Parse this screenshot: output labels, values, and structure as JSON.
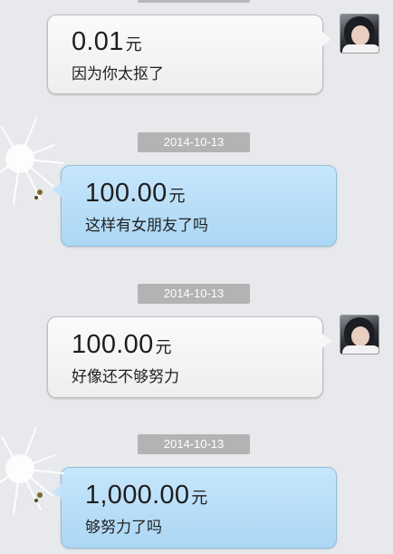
{
  "colors": {
    "background": "#e7e9ec",
    "timestamp_bg": "#b3b3b3",
    "outgoing_bubble": "#f4f4f4",
    "incoming_bubble": "#b8ddf7"
  },
  "messages": [
    {
      "direction": "outgoing",
      "amount": "0.01",
      "unit": "元",
      "note": "因为你太抠了",
      "avatar_icon": "user-avatar-icon"
    },
    {
      "timestamp": "2014-10-13",
      "direction": "incoming",
      "amount": "100.00",
      "unit": "元",
      "note": "这样有女朋友了吗"
    },
    {
      "timestamp": "2014-10-13",
      "direction": "outgoing",
      "amount": "100.00",
      "unit": "元",
      "note": "好像还不够努力",
      "avatar_icon": "user-avatar-icon"
    },
    {
      "timestamp": "2014-10-13",
      "direction": "incoming",
      "amount": "1,000.00",
      "unit": "元",
      "note": "够努力了吗"
    }
  ]
}
